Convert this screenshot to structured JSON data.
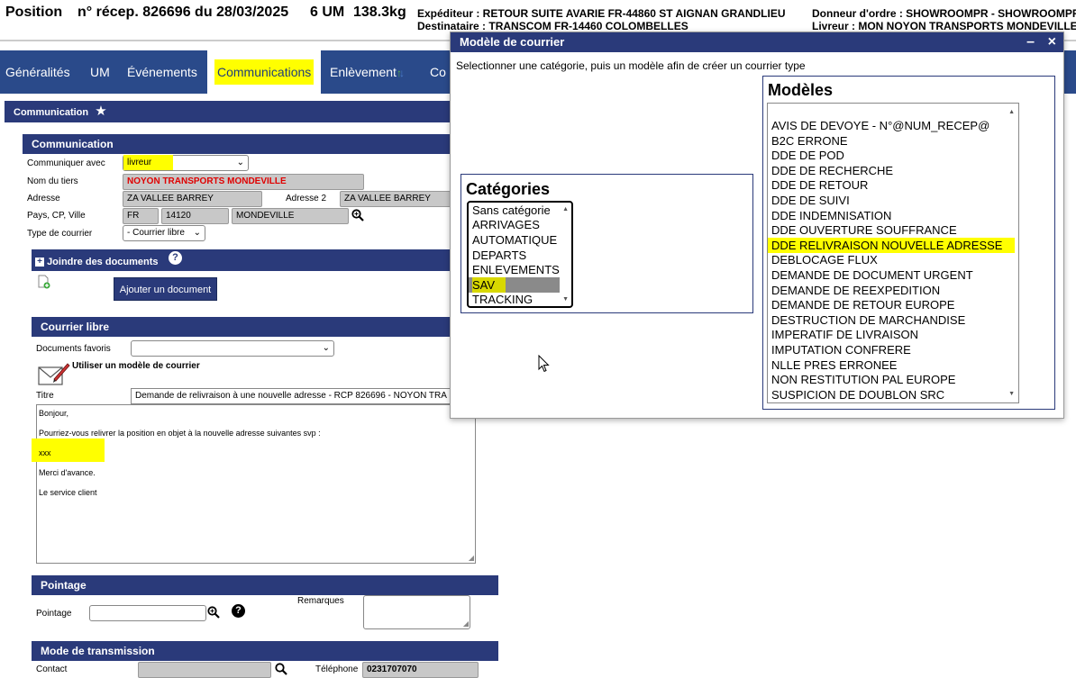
{
  "header": {
    "position_label": "Position",
    "recep": "n° récep. 826696 du 28/03/2025",
    "um": "6 UM",
    "weight": "138.3kg",
    "expediteur": "Expéditeur : RETOUR SUITE AVARIE FR-44860 ST AIGNAN GRANDLIEU",
    "destinataire": "Destinataire : TRANSCOM FR-14460 COLOMBELLES",
    "donneur": "Donneur d'ordre : SHOWROOMPR - SHOWROOMPR",
    "livreur": "Livreur : MON NOYON TRANSPORTS MONDEVILLE"
  },
  "tabs": [
    {
      "label": "Généralités"
    },
    {
      "label": "UM"
    },
    {
      "label": "Événements"
    },
    {
      "label": "Communications"
    },
    {
      "label": "Enlèvement"
    },
    {
      "label": "Co"
    }
  ],
  "communication_bar": "Communication",
  "communication_section": {
    "title": "Communication",
    "communiquer_label": "Communiquer avec",
    "communiquer_value": "livreur",
    "nom_label": "Nom du tiers",
    "nom_value": "NOYON TRANSPORTS MONDEVILLE",
    "adresse_label": "Adresse",
    "adresse_value": "ZA VALLEE BARREY",
    "adresse2_label": "Adresse 2",
    "adresse2_value": "ZA VALLEE BARREY",
    "pays_label": "Pays, CP, Ville",
    "pays": "FR",
    "cp": "14120",
    "ville": "MONDEVILLE",
    "type_label": "Type de courrier",
    "type_value": "- Courrier libre"
  },
  "joindre": {
    "title": "Joindre des documents",
    "help": "?",
    "button": "Ajouter un document"
  },
  "courrier": {
    "title": "Courrier libre",
    "favoris_label": "Documents favoris",
    "modele_link": "Utiliser un modèle de courrier",
    "titre_label": "Titre",
    "titre_value": "Demande de relivraison à une nouvelle adresse - RCP 826696 - NOYON TRA",
    "body": [
      "Bonjour,",
      "Pourriez-vous relivrer la position en objet à la nouvelle adresse suivantes svp :",
      "xxx",
      "Merci d'avance.",
      "Le service client"
    ]
  },
  "pointage": {
    "title": "Pointage",
    "label": "Pointage",
    "remarques": "Remarques",
    "help": "?"
  },
  "transmission": {
    "title": "Mode de transmission",
    "contact": "Contact",
    "telephone_label": "Téléphone",
    "telephone_value": "0231707070"
  },
  "modal": {
    "title": "Modèle de courrier",
    "minimize": "–",
    "close": "×",
    "instruction": "Selectionner une catégorie, puis un modèle afin de créer un courrier type",
    "categories_title": "Catégories",
    "categories": [
      "Sans catégorie",
      "ARRIVAGES",
      "AUTOMATIQUE",
      "DEPARTS",
      "ENLEVEMENTS",
      "SAV",
      "TRACKING"
    ],
    "selected_category": "SAV",
    "modeles_title": "Modèles",
    "modeles": [
      "AVIS DE DEVOYE - N°@NUM_RECEP@",
      "B2C ERRONE",
      "DDE DE POD",
      "DDE DE RECHERCHE",
      "DDE DE RETOUR",
      "DDE DE SUIVI",
      "DDE INDEMNISATION",
      "DDE OUVERTURE SOUFFRANCE",
      "DDE RELIVRAISON NOUVELLE ADRESSE",
      "DEBLOCAGE FLUX",
      "DEMANDE DE DOCUMENT URGENT",
      "DEMANDE DE REEXPEDITION",
      "DEMANDE DE RETOUR EUROPE",
      "DESTRUCTION DE MARCHANDISE",
      "IMPERATIF DE LIVRAISON",
      "IMPUTATION CONFRERE",
      "NLLE PRES ERRONEE",
      "NON RESTITUTION PAL EUROPE",
      "SUSPICION DE DOUBLON SRC"
    ],
    "highlighted_modele": "DDE RELIVRAISON NOUVELLE ADRESSE"
  },
  "colors": {
    "nav_bg": "#2a4a8a",
    "bar_bg": "#2a3a7a",
    "highlight": "#ffff00",
    "required_red": "#e00000"
  }
}
